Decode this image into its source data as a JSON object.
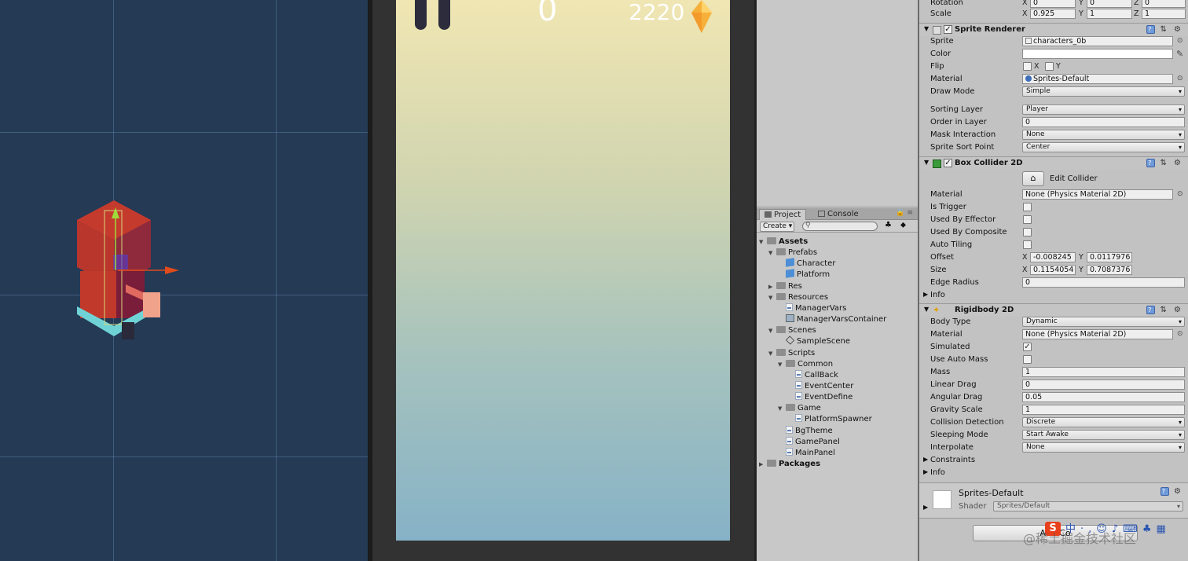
{
  "game": {
    "score": "0",
    "gem_count": "2220"
  },
  "project": {
    "tab_project": "Project",
    "tab_console": "Console",
    "create_label": "Create",
    "tree": [
      {
        "label": "Assets",
        "depth": 0,
        "type": "folder",
        "bold": true,
        "open": true
      },
      {
        "label": "Prefabs",
        "depth": 1,
        "type": "folder",
        "open": true
      },
      {
        "label": "Character",
        "depth": 2,
        "type": "prefab"
      },
      {
        "label": "Platform",
        "depth": 2,
        "type": "prefab"
      },
      {
        "label": "Res",
        "depth": 1,
        "type": "folder",
        "open": false
      },
      {
        "label": "Resources",
        "depth": 1,
        "type": "folder",
        "open": true
      },
      {
        "label": "ManagerVars",
        "depth": 2,
        "type": "script"
      },
      {
        "label": "ManagerVarsContainer",
        "depth": 2,
        "type": "asset"
      },
      {
        "label": "Scenes",
        "depth": 1,
        "type": "folder",
        "open": true
      },
      {
        "label": "SampleScene",
        "depth": 2,
        "type": "scene"
      },
      {
        "label": "Scripts",
        "depth": 1,
        "type": "folder",
        "open": true
      },
      {
        "label": "Common",
        "depth": 2,
        "type": "folder",
        "open": true
      },
      {
        "label": "CallBack",
        "depth": 3,
        "type": "script"
      },
      {
        "label": "EventCenter",
        "depth": 3,
        "type": "script"
      },
      {
        "label": "EventDefine",
        "depth": 3,
        "type": "script"
      },
      {
        "label": "Game",
        "depth": 2,
        "type": "folder",
        "open": true
      },
      {
        "label": "PlatformSpawner",
        "depth": 3,
        "type": "script"
      },
      {
        "label": "BgTheme",
        "depth": 2,
        "type": "script"
      },
      {
        "label": "GamePanel",
        "depth": 2,
        "type": "script"
      },
      {
        "label": "MainPanel",
        "depth": 2,
        "type": "script"
      },
      {
        "label": "Packages",
        "depth": 0,
        "type": "folder",
        "bold": true,
        "open": false
      }
    ]
  },
  "inspector": {
    "transform": {
      "rotation_label": "Rotation",
      "rotation": {
        "x": "0",
        "y": "0",
        "z": "0"
      },
      "scale_label": "Scale",
      "scale": {
        "x": "0.925",
        "y": "1",
        "z": "1"
      }
    },
    "sprite_renderer": {
      "title": "Sprite Renderer",
      "sprite_label": "Sprite",
      "sprite_value": "characters_0b",
      "color_label": "Color",
      "flip_label": "Flip",
      "flip_x": "X",
      "flip_y": "Y",
      "material_label": "Material",
      "material_value": "Sprites-Default",
      "draw_mode_label": "Draw Mode",
      "draw_mode_value": "Simple",
      "sorting_layer_label": "Sorting Layer",
      "sorting_layer_value": "Player",
      "order_label": "Order in Layer",
      "order_value": "0",
      "mask_label": "Mask Interaction",
      "mask_value": "None",
      "sort_point_label": "Sprite Sort Point",
      "sort_point_value": "Center"
    },
    "box_collider": {
      "title": "Box Collider 2D",
      "edit_collider": "Edit Collider",
      "material_label": "Material",
      "material_value": "None (Physics Material 2D)",
      "is_trigger_label": "Is Trigger",
      "used_by_effector_label": "Used By Effector",
      "used_by_composite_label": "Used By Composite",
      "auto_tiling_label": "Auto Tiling",
      "offset_label": "Offset",
      "offset": {
        "x": "-0.008245",
        "y": "0.0117976"
      },
      "size_label": "Size",
      "size": {
        "x": "0.1154054",
        "y": "0.7087376"
      },
      "edge_radius_label": "Edge Radius",
      "edge_radius_value": "0",
      "info_label": "Info"
    },
    "rigidbody": {
      "title": "Rigidbody 2D",
      "body_type_label": "Body Type",
      "body_type_value": "Dynamic",
      "material_label": "Material",
      "material_value": "None (Physics Material 2D)",
      "simulated_label": "Simulated",
      "use_auto_mass_label": "Use Auto Mass",
      "mass_label": "Mass",
      "mass_value": "1",
      "linear_drag_label": "Linear Drag",
      "linear_drag_value": "0",
      "angular_drag_label": "Angular Drag",
      "angular_drag_value": "0.05",
      "gravity_label": "Gravity Scale",
      "gravity_value": "1",
      "collision_label": "Collision Detection",
      "collision_value": "Discrete",
      "sleeping_label": "Sleeping Mode",
      "sleeping_value": "Start Awake",
      "interpolate_label": "Interpolate",
      "interpolate_value": "None",
      "constraints_label": "Constraints",
      "info_label": "Info"
    },
    "material_preview": {
      "name": "Sprites-Default",
      "shader_label": "Shader",
      "shader_value": "Sprites/Default"
    },
    "add_component": "Add Co",
    "watermark": "@稀土掘金技术社区"
  }
}
